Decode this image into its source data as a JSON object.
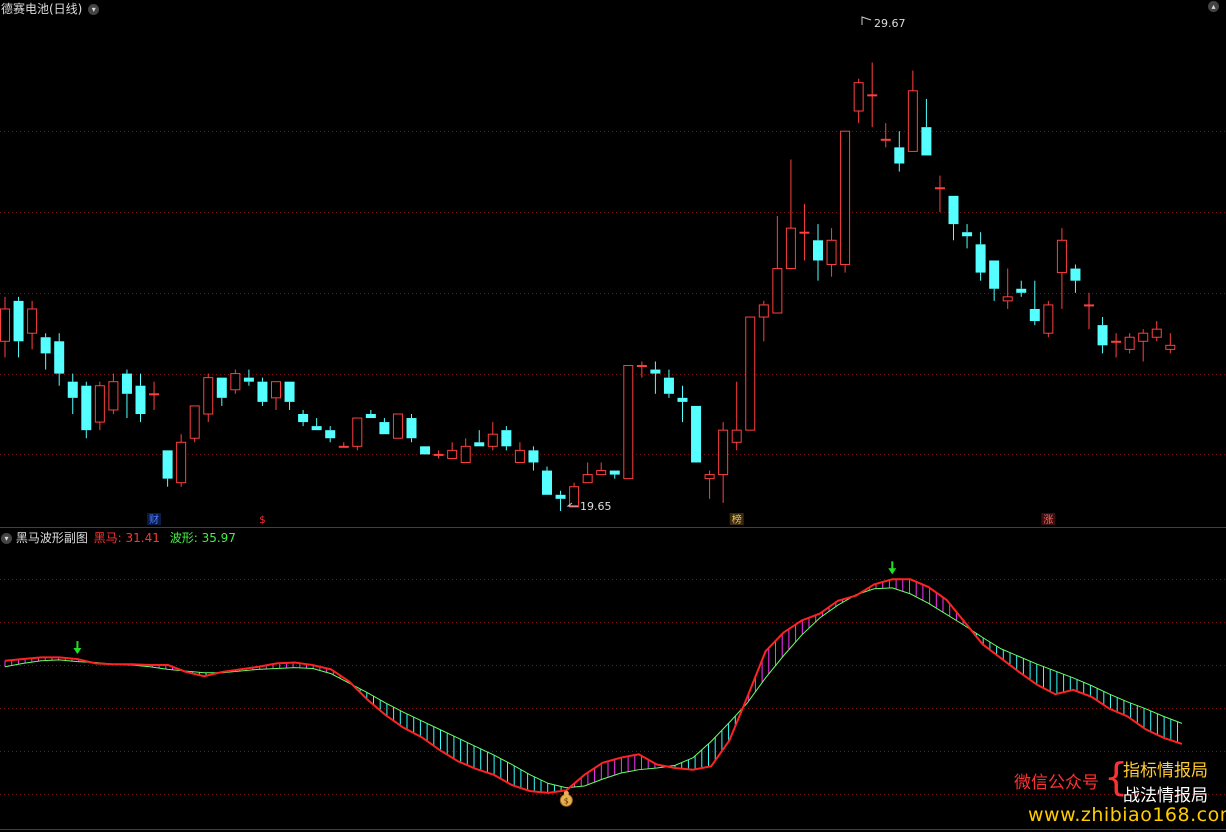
{
  "main_panel": {
    "title": "德赛电池(日线)",
    "high_label": "29.67",
    "low_label": "19.65",
    "markers": [
      {
        "text": "财",
        "color": "#4f7bff",
        "bg": "#0b1b48"
      },
      {
        "text": "$",
        "color": "#ff3030",
        "bg": "#000000"
      },
      {
        "text": "榜",
        "color": "#e8c060",
        "bg": "#3a2a10"
      },
      {
        "text": "涨",
        "color": "#ff6060",
        "bg": "#3a1010"
      }
    ]
  },
  "sub_panel": {
    "title": "黑马波形副图",
    "series1_label": "黑马: 31.41",
    "series2_label": "波形: 35.97",
    "colors": {
      "series1": "#ff2222",
      "series2": "#66ff66",
      "hatch_up": "#ff33ff",
      "hatch_down": "#33ffff",
      "up_candle": "#ff4040",
      "down_candle": "#55ffff",
      "dotted": "#7a1010"
    }
  },
  "watermark": {
    "left": "微信公众号",
    "right_top": "指标情报局",
    "right_bottom": "战法情报局",
    "url": "www.zhibiao168.com"
  },
  "chart_data": {
    "type": "candlestick",
    "candles": [
      [
        22.8,
        23.6,
        23.9,
        22.4
      ],
      [
        23.8,
        22.8,
        23.9,
        22.4
      ],
      [
        23.0,
        23.6,
        23.8,
        22.6
      ],
      [
        22.9,
        22.5,
        23.0,
        22.1
      ],
      [
        22.8,
        22.0,
        23.0,
        21.7
      ],
      [
        21.8,
        21.4,
        22.0,
        21.0
      ],
      [
        21.7,
        20.6,
        21.8,
        20.4
      ],
      [
        20.8,
        21.7,
        21.8,
        20.6
      ],
      [
        21.1,
        21.8,
        22.0,
        21.0
      ],
      [
        22.0,
        21.5,
        22.1,
        20.9
      ],
      [
        21.7,
        21.0,
        22.0,
        20.8
      ],
      [
        21.5,
        21.5,
        21.8,
        21.1
      ],
      [
        20.1,
        19.4,
        20.1,
        19.2
      ],
      [
        19.3,
        20.3,
        20.5,
        19.2
      ],
      [
        20.4,
        21.2,
        21.2,
        20.3
      ],
      [
        21.0,
        21.9,
        22.0,
        20.8
      ],
      [
        21.9,
        21.4,
        21.9,
        21.2
      ],
      [
        21.6,
        22.0,
        22.1,
        21.5
      ],
      [
        21.9,
        21.8,
        22.1,
        21.7
      ],
      [
        21.8,
        21.3,
        21.9,
        21.2
      ],
      [
        21.4,
        21.8,
        21.8,
        21.1
      ],
      [
        21.8,
        21.3,
        21.8,
        21.1
      ],
      [
        21.0,
        20.8,
        21.1,
        20.7
      ],
      [
        20.7,
        20.6,
        20.9,
        20.6
      ],
      [
        20.6,
        20.4,
        20.7,
        20.3
      ],
      [
        20.2,
        20.2,
        20.3,
        20.2
      ],
      [
        20.2,
        20.9,
        20.9,
        20.1
      ],
      [
        21.0,
        20.9,
        21.1,
        20.9
      ],
      [
        20.8,
        20.5,
        20.9,
        20.5
      ],
      [
        20.4,
        21.0,
        21.0,
        20.4
      ],
      [
        20.9,
        20.4,
        21.0,
        20.3
      ],
      [
        20.2,
        20.0,
        20.2,
        20.0
      ],
      [
        20.0,
        20.0,
        20.1,
        19.9
      ],
      [
        19.9,
        20.1,
        20.3,
        19.9
      ],
      [
        19.8,
        20.2,
        20.4,
        19.8
      ],
      [
        20.3,
        20.2,
        20.6,
        20.2
      ],
      [
        20.2,
        20.5,
        20.8,
        20.1
      ],
      [
        20.6,
        20.2,
        20.7,
        20.1
      ],
      [
        19.8,
        20.1,
        20.3,
        19.8
      ],
      [
        20.1,
        19.8,
        20.2,
        19.6
      ],
      [
        19.6,
        19.0,
        19.7,
        19.0
      ],
      [
        19.0,
        18.9,
        19.1,
        18.6
      ],
      [
        18.7,
        19.2,
        19.3,
        18.7
      ],
      [
        19.3,
        19.5,
        19.8,
        19.3
      ],
      [
        19.5,
        19.6,
        19.8,
        19.5
      ],
      [
        19.6,
        19.5,
        19.6,
        19.4
      ],
      [
        19.4,
        22.2,
        22.2,
        19.4
      ],
      [
        22.2,
        22.2,
        22.3,
        21.9
      ],
      [
        22.1,
        22.0,
        22.3,
        21.5
      ],
      [
        21.9,
        21.5,
        22.1,
        21.4
      ],
      [
        21.4,
        21.3,
        21.7,
        20.8
      ],
      [
        21.2,
        19.8,
        21.2,
        19.8
      ],
      [
        19.4,
        19.5,
        19.6,
        18.9
      ],
      [
        19.5,
        20.6,
        20.8,
        18.8
      ],
      [
        20.3,
        20.6,
        21.8,
        20.1
      ],
      [
        20.6,
        23.4,
        23.4,
        20.6
      ],
      [
        23.4,
        23.7,
        23.8,
        22.8
      ],
      [
        23.5,
        24.6,
        25.9,
        23.5
      ],
      [
        24.6,
        25.6,
        27.3,
        24.6
      ],
      [
        25.5,
        25.5,
        26.2,
        24.8
      ],
      [
        25.3,
        24.8,
        25.7,
        24.3
      ],
      [
        24.7,
        25.3,
        25.6,
        24.4
      ],
      [
        24.7,
        28.0,
        28.0,
        24.5
      ],
      [
        28.5,
        29.2,
        29.3,
        28.2
      ],
      [
        28.9,
        28.9,
        29.7,
        28.1
      ],
      [
        27.8,
        27.8,
        28.2,
        27.6
      ],
      [
        27.6,
        27.2,
        28.0,
        27.0
      ],
      [
        27.5,
        29.0,
        29.5,
        27.5
      ],
      [
        28.1,
        27.4,
        28.8,
        27.4
      ],
      [
        26.6,
        26.6,
        26.9,
        26.0
      ],
      [
        26.4,
        25.7,
        26.4,
        25.3
      ],
      [
        25.5,
        25.4,
        25.7,
        25.1
      ],
      [
        25.2,
        24.5,
        25.5,
        24.3
      ],
      [
        24.8,
        24.1,
        24.8,
        23.8
      ],
      [
        23.8,
        23.9,
        24.6,
        23.6
      ],
      [
        24.1,
        24.0,
        24.3,
        23.9
      ],
      [
        23.6,
        23.3,
        24.3,
        23.2
      ],
      [
        23.0,
        23.7,
        23.8,
        22.9
      ],
      [
        24.5,
        25.3,
        25.6,
        23.6
      ],
      [
        24.6,
        24.3,
        24.7,
        24.0
      ],
      [
        23.7,
        23.7,
        24.0,
        23.1
      ],
      [
        23.2,
        22.7,
        23.4,
        22.5
      ],
      [
        22.8,
        22.8,
        23.0,
        22.4
      ],
      [
        22.6,
        22.9,
        23.0,
        22.5
      ],
      [
        22.8,
        23.0,
        23.1,
        22.3
      ],
      [
        22.9,
        23.1,
        23.3,
        22.8
      ],
      [
        22.6,
        22.7,
        23.0,
        22.5
      ]
    ],
    "ylim": [
      18.5,
      31.0
    ],
    "high": {
      "index": 64,
      "value": 29.67
    },
    "low": {
      "index": 41,
      "value": 19.65
    },
    "sub_series": {
      "heima": [
        24.5,
        24.7,
        24.9,
        24.9,
        24.7,
        24.2,
        24.1,
        24.1,
        24.0,
        24.0,
        23.2,
        22.7,
        23.2,
        23.5,
        23.8,
        24.2,
        24.3,
        24.0,
        23.5,
        22.1,
        20.0,
        18.2,
        16.7,
        15.6,
        14.1,
        12.8,
        11.9,
        11.2,
        10.0,
        9.3,
        9.1,
        9.4,
        11.2,
        12.6,
        13.2,
        13.6,
        12.4,
        12.0,
        11.8,
        12.2,
        15.2,
        20.3,
        25.6,
        27.8,
        29.2,
        30.0,
        31.5,
        32.1,
        33.4,
        34.0,
        34.0,
        33.1,
        31.6,
        29.0,
        26.4,
        24.8,
        23.2,
        21.7,
        20.6,
        21.1,
        20.3,
        18.9,
        18.0,
        16.5,
        15.5,
        14.8
      ],
      "boxing": [
        23.8,
        24.2,
        24.5,
        24.6,
        24.4,
        24.3,
        24.1,
        24.0,
        23.8,
        23.5,
        23.3,
        23.1,
        23.1,
        23.3,
        23.5,
        23.6,
        23.7,
        23.6,
        23.0,
        21.9,
        20.8,
        19.6,
        18.5,
        17.5,
        16.5,
        15.5,
        14.5,
        13.5,
        12.4,
        11.2,
        10.2,
        9.7,
        9.9,
        10.7,
        11.4,
        11.8,
        12.0,
        12.3,
        13.2,
        15.1,
        17.3,
        19.6,
        22.5,
        25.1,
        27.5,
        29.5,
        31.0,
        32.2,
        32.9,
        33.0,
        32.3,
        31.2,
        29.9,
        28.6,
        27.2,
        25.9,
        25.0,
        24.1,
        23.3,
        22.5,
        21.6,
        20.6,
        19.7,
        18.9,
        18.0,
        17.2
      ],
      "ylim": [
        5,
        38
      ],
      "sell_signals": [
        4,
        49
      ],
      "buy_signal": 31
    }
  }
}
